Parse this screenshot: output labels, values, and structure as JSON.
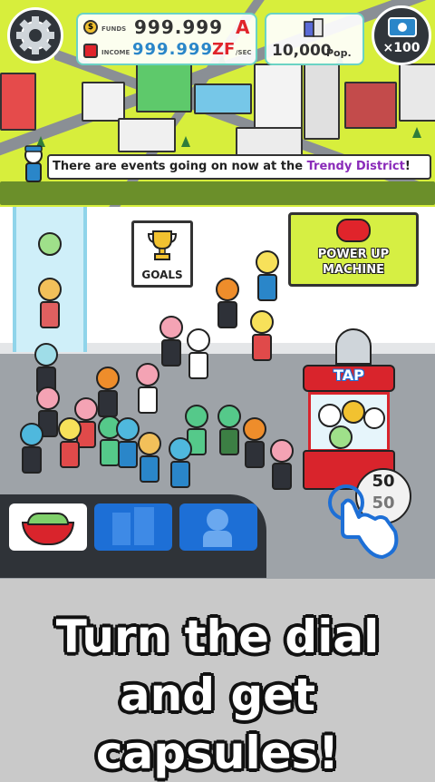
{
  "hud": {
    "funds_label": "FUNDS",
    "funds_value": "999.999",
    "funds_unit": "A",
    "income_label": "INCOME",
    "income_value": "999.999",
    "income_unit": "ZF",
    "income_per": "/SEC",
    "population_value": "10,000",
    "population_unit": "Pop.",
    "ticket_count": "×100"
  },
  "banner": {
    "text_prefix": "There are events going on now at the ",
    "district": "Trendy District",
    "text_suffix": "!"
  },
  "signs": {
    "goals": "GOALS",
    "power_up_line1": "POWER UP",
    "power_up_line2": "MACHINE",
    "tap": "TAP"
  },
  "dial": {
    "top_number": "50",
    "bottom_number": "50"
  },
  "caption": {
    "line1": "Turn the dial",
    "line2": "and get capsules!"
  },
  "colors": {
    "map_ground": "#d7ee3c",
    "accent_teal": "#6bd3c4",
    "district_purple": "#8a2bb9",
    "funds_red": "#e0242b",
    "income_blue": "#2a86c9",
    "tab_blue": "#1d6fd6",
    "machine_red": "#d9242c"
  },
  "icons": [
    "gear-icon",
    "coin-icon",
    "income-icon",
    "population-icon",
    "ticket-icon",
    "mascot-icon",
    "trophy-icon",
    "hand-pointer-icon"
  ]
}
